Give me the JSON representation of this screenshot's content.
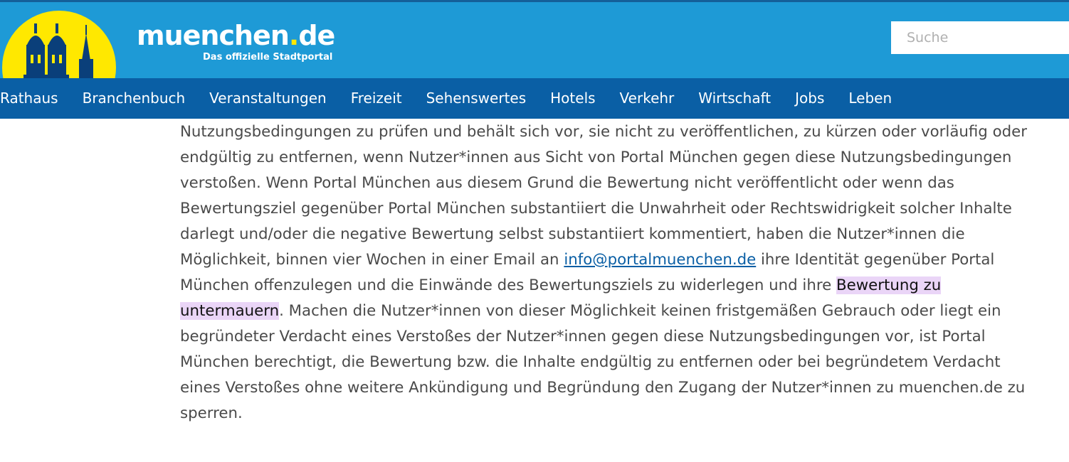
{
  "header": {
    "brand_main": "muenchen",
    "brand_dot": ".",
    "brand_tld": "de",
    "tagline": "Das offizielle Stadtportal",
    "search_placeholder": "Suche",
    "colors": {
      "topbar": "#1e9ad6",
      "navbar": "#0a5fa5",
      "logo_sun": "#ffe800"
    }
  },
  "nav": {
    "items": [
      "Rathaus",
      "Branchenbuch",
      "Veranstaltungen",
      "Freizeit",
      "Sehenswertes",
      "Hotels",
      "Verkehr",
      "Wirtschaft",
      "Jobs",
      "Leben"
    ]
  },
  "content": {
    "text_before_link": "Nutzungsbedingungen zu prüfen und behält sich vor, sie nicht zu veröffentlichen, zu kürzen oder vorläufig oder endgültig zu entfernen, wenn Nutzer*innen aus Sicht von Portal München gegen diese Nutzungsbedingungen verstoßen. Wenn Portal München aus diesem Grund die Bewertung nicht veröffentlicht oder wenn das Bewertungsziel gegenüber Portal München substantiiert die Unwahrheit oder Rechtswidrigkeit solcher Inhalte darlegt und/oder die negative Bewertung selbst substantiiert kommentiert, haben die Nutzer*innen die Möglichkeit, binnen vier Wochen in einer Email an ",
    "email_link": "info@portalmuenchen.de",
    "text_after_link": " ihre Identität gegenüber Portal München offenzulegen und die Einwände des Bewertungsziels zu widerlegen und ihre ",
    "highlighted": "Bewertung zu untermauern",
    "text_end": ". Machen die Nutzer*innen von dieser Möglichkeit keinen fristgemäßen Gebrauch oder liegt ein begründeter Verdacht eines Verstoßes der Nutzer*innen gegen diese Nutzungsbedingungen vor, ist Portal München berechtigt, die Bewertung bzw. die Inhalte endgültig zu entfernen oder bei begründetem Verdacht eines Verstoßes ohne weitere Ankündigung und Begründung den Zugang der Nutzer*innen zu muenchen.de zu sperren.",
    "highlight_color": "#ead5f7"
  }
}
